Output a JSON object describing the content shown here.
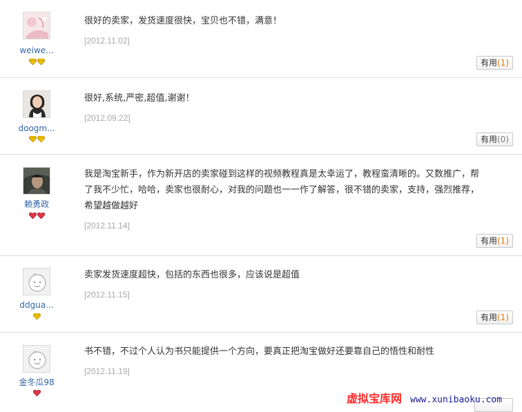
{
  "reviews": [
    {
      "username": "weiwe...",
      "avatar": "photo-avatar-pink",
      "badge_type": "gold",
      "badge_count": 2,
      "comment": "很好的卖家，发货速度很快，宝贝也不错，满意！",
      "date": "[2012.11.02]",
      "useful_label": "有用",
      "useful_count": "(1)"
    },
    {
      "username": "doogm...",
      "avatar": "photo-avatar-woman",
      "badge_type": "gold",
      "badge_count": 2,
      "comment": "很好,系统,严密,超值,谢谢！",
      "date": "[2012.09.22]",
      "useful_label": "有用",
      "useful_count": "(0)"
    },
    {
      "username": "赖勇政",
      "avatar": "photo-avatar-man",
      "badge_type": "red",
      "badge_count": 2,
      "comment": "我是淘宝新手，作为新开店的卖家碰到这样的视频教程真是太幸运了，教程蛮清晰的。又数推广，帮了我不少忙，哈哈，卖家也很耐心，对我的问题也一一作了解答，很不错的卖家，支持，强烈推荐，希望越做越好",
      "date": "[2012.11.14]",
      "useful_label": "有用",
      "useful_count": "(1)"
    },
    {
      "username": "ddgua...",
      "avatar": "default-avatar",
      "badge_type": "gold",
      "badge_count": 1,
      "comment": "卖家发货速度超快，包括的东西也很多，应该说是超值",
      "date": "[2012.11.15]",
      "useful_label": "有用",
      "useful_count": "(1)"
    },
    {
      "username": "金冬瓜98",
      "avatar": "default-avatar",
      "badge_type": "red",
      "badge_count": 1,
      "comment": "书不错，不过个人认为书只能提供一个方向，要真正把淘宝做好还要靠自己的悟性和耐性",
      "date": "[2012.11.19]",
      "useful_label": "",
      "useful_count": ""
    }
  ],
  "watermark": {
    "site_name": "虚拟宝库网",
    "url": "www.xunibaoku.com"
  },
  "colors": {
    "username": "#3366aa",
    "useful_count": "#e07b00",
    "date": "#a8a8a8",
    "watermark_red": "#ff2b2b",
    "watermark_blue": "#1a1a99"
  }
}
